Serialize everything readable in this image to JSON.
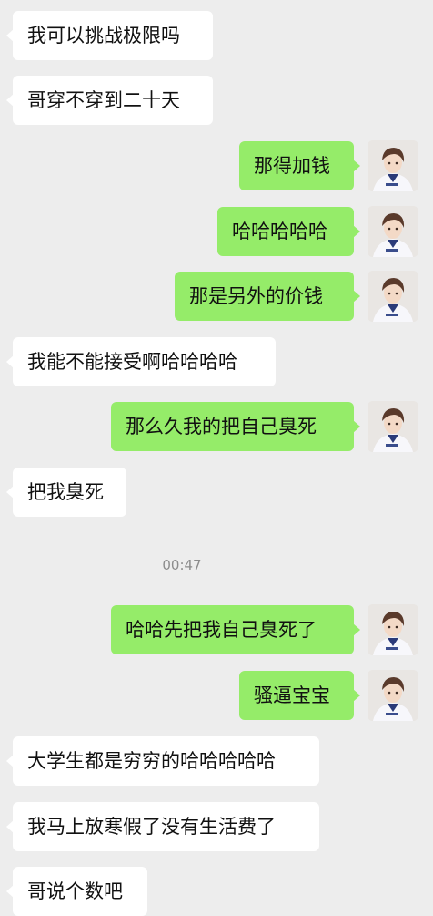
{
  "messages": [
    {
      "side": "in",
      "text": "我可以挑战极限吗"
    },
    {
      "side": "in",
      "text": "哥穿不穿到二十天"
    },
    {
      "side": "out",
      "text": "那得加钱"
    },
    {
      "side": "out",
      "text": "哈哈哈哈哈"
    },
    {
      "side": "out",
      "text": "那是另外的价钱"
    },
    {
      "side": "in",
      "text": "我能不能接受啊哈哈哈哈"
    },
    {
      "side": "out",
      "text": "那么久我的把自己臭死"
    },
    {
      "side": "in",
      "text": "把我臭死"
    },
    {
      "side": "out",
      "text": "哈哈先把我自己臭死了"
    },
    {
      "side": "out",
      "text": "骚逼宝宝"
    },
    {
      "side": "in",
      "text": "大学生都是穷穷的哈哈哈哈哈"
    },
    {
      "side": "in",
      "text": "我马上放寒假了没有生活费了"
    },
    {
      "side": "in",
      "text": "哥说个数吧"
    }
  ],
  "timestamp": "00:47",
  "colors": {
    "background": "#ededed",
    "incoming": "#ffffff",
    "outgoing": "#95ec69"
  }
}
